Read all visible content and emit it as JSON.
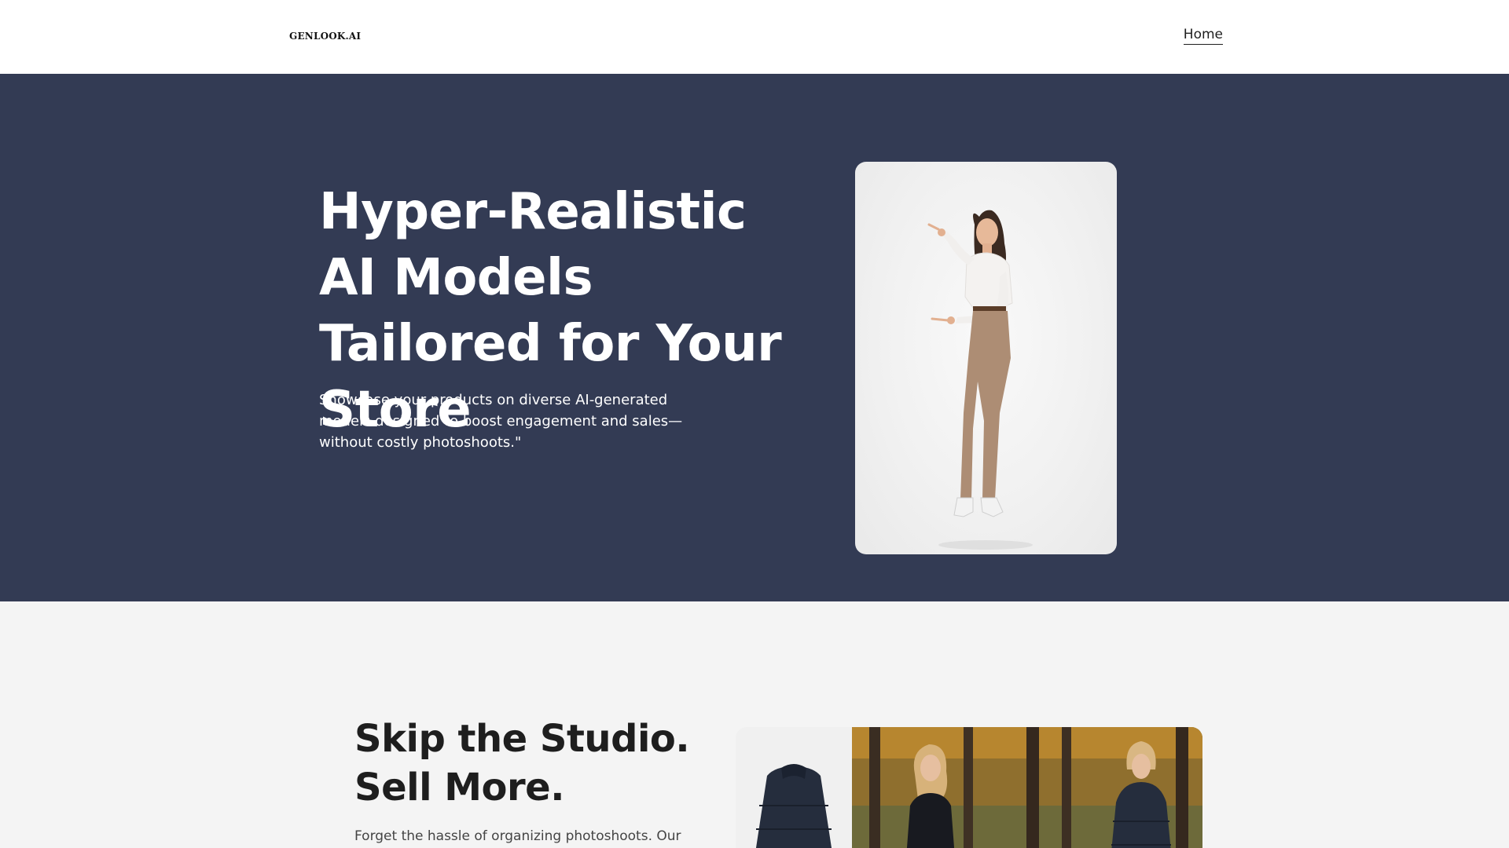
{
  "header": {
    "logo": "GENLOOK.AI",
    "nav": {
      "home_label": "Home"
    }
  },
  "hero": {
    "title": "Hyper-Realistic AI Models Tailored for Your Store",
    "description": "Showcase your products on diverse AI-generated models designed to boost engagement and sales—without costly photoshoots.\""
  },
  "feature": {
    "title_line1": "Skip the Studio.",
    "title_line2": "Sell More.",
    "description": "Forget the hassle of organizing photoshoots. Our"
  },
  "colors": {
    "header_bg": "#ffffff",
    "hero_bg": "#333b54",
    "section_bg": "#f4f4f4",
    "text_dark": "#1e1e1e"
  }
}
